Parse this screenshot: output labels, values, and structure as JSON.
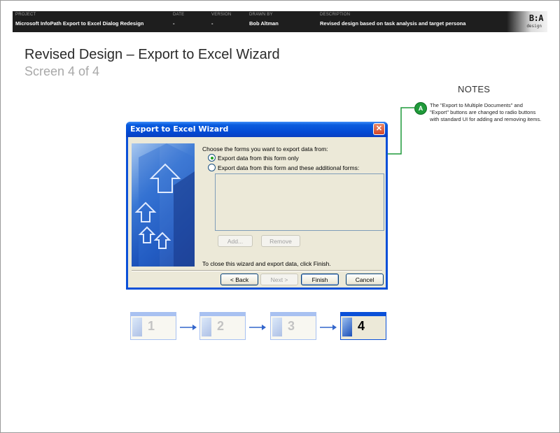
{
  "header": {
    "project_label": "PROJECT",
    "project_value": "Microsoft InfoPath Export to Excel Dialog Redesign",
    "date_label": "DATE",
    "date_value": "-",
    "version_label": "VERSION",
    "version_value": "-",
    "drawn_by_label": "DRAWN BY",
    "drawn_by_value": "Bob Altman",
    "description_label": "DESCRIPTION",
    "description_value": "Revised design based on task analysis and target persona",
    "logo_text": "B:A",
    "logo_subtext": "design"
  },
  "page": {
    "title": "Revised Design – Export to Excel Wizard",
    "subtitle": "Screen 4 of 4"
  },
  "notes": {
    "heading": "NOTES",
    "items": [
      {
        "badge": "A",
        "text": "The \"Export to Multiple Documents\" and \"Export\" buttons are changed to radio buttons with standard UI for adding and removing items."
      }
    ],
    "accent_color": "#1f9a3a"
  },
  "dialog": {
    "title": "Export to Excel Wizard",
    "close_glyph": "✕",
    "instruction": "Choose the forms you want to export data from:",
    "radio_this_form": "Export data from this form only",
    "radio_additional": "Export data from this form and these additional forms:",
    "selected_option": "radio_this_form",
    "add_label": "Add...",
    "remove_label": "Remove",
    "close_hint": "To close this wizard and export data, click Finish.",
    "back_label": "< Back",
    "next_label": "Next >",
    "finish_label": "Finish",
    "cancel_label": "Cancel",
    "titlebar_color": "#0a50d8",
    "client_color": "#ece9d8"
  },
  "steps": [
    {
      "number": "1",
      "state": "faded"
    },
    {
      "number": "2",
      "state": "faded"
    },
    {
      "number": "3",
      "state": "faded"
    },
    {
      "number": "4",
      "state": "current"
    }
  ],
  "step_arrow_color": "#3366cc"
}
